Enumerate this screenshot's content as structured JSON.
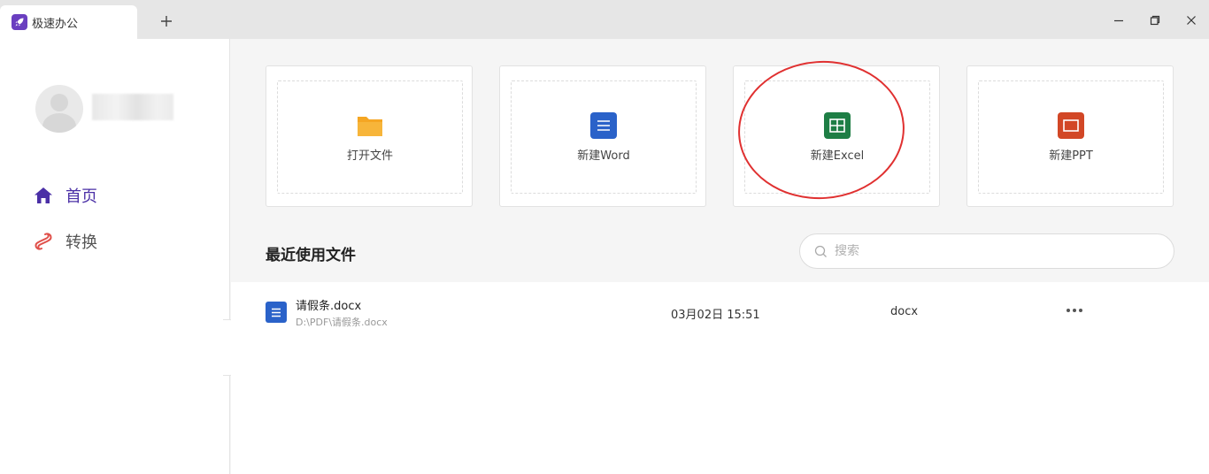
{
  "window": {
    "tab_title": "极速办公",
    "new_tab_icon": "plus-icon",
    "controls": [
      "minimize-icon",
      "restore-icon",
      "close-icon"
    ]
  },
  "sidebar": {
    "nav": [
      {
        "label": "首页",
        "icon": "home-icon",
        "active": true,
        "color": "#4a2fa6"
      },
      {
        "label": "转换",
        "icon": "convert-icon",
        "active": false,
        "color": "#e0504a"
      }
    ]
  },
  "actions": [
    {
      "label": "打开文件",
      "icon": "folder-icon",
      "color": "#f5a623"
    },
    {
      "label": "新建Word",
      "icon": "word-icon",
      "color": "#2a62c9"
    },
    {
      "label": "新建Excel",
      "icon": "excel-icon",
      "color": "#1e7e45"
    },
    {
      "label": "新建PPT",
      "icon": "ppt-icon",
      "color": "#d24726"
    }
  ],
  "recent": {
    "title": "最近使用文件",
    "search_placeholder": "搜索",
    "files": [
      {
        "name": "请假条.docx",
        "path": "D:\\PDF\\请假条.docx",
        "date": "03月02日 15:51",
        "type": "docx"
      }
    ]
  }
}
